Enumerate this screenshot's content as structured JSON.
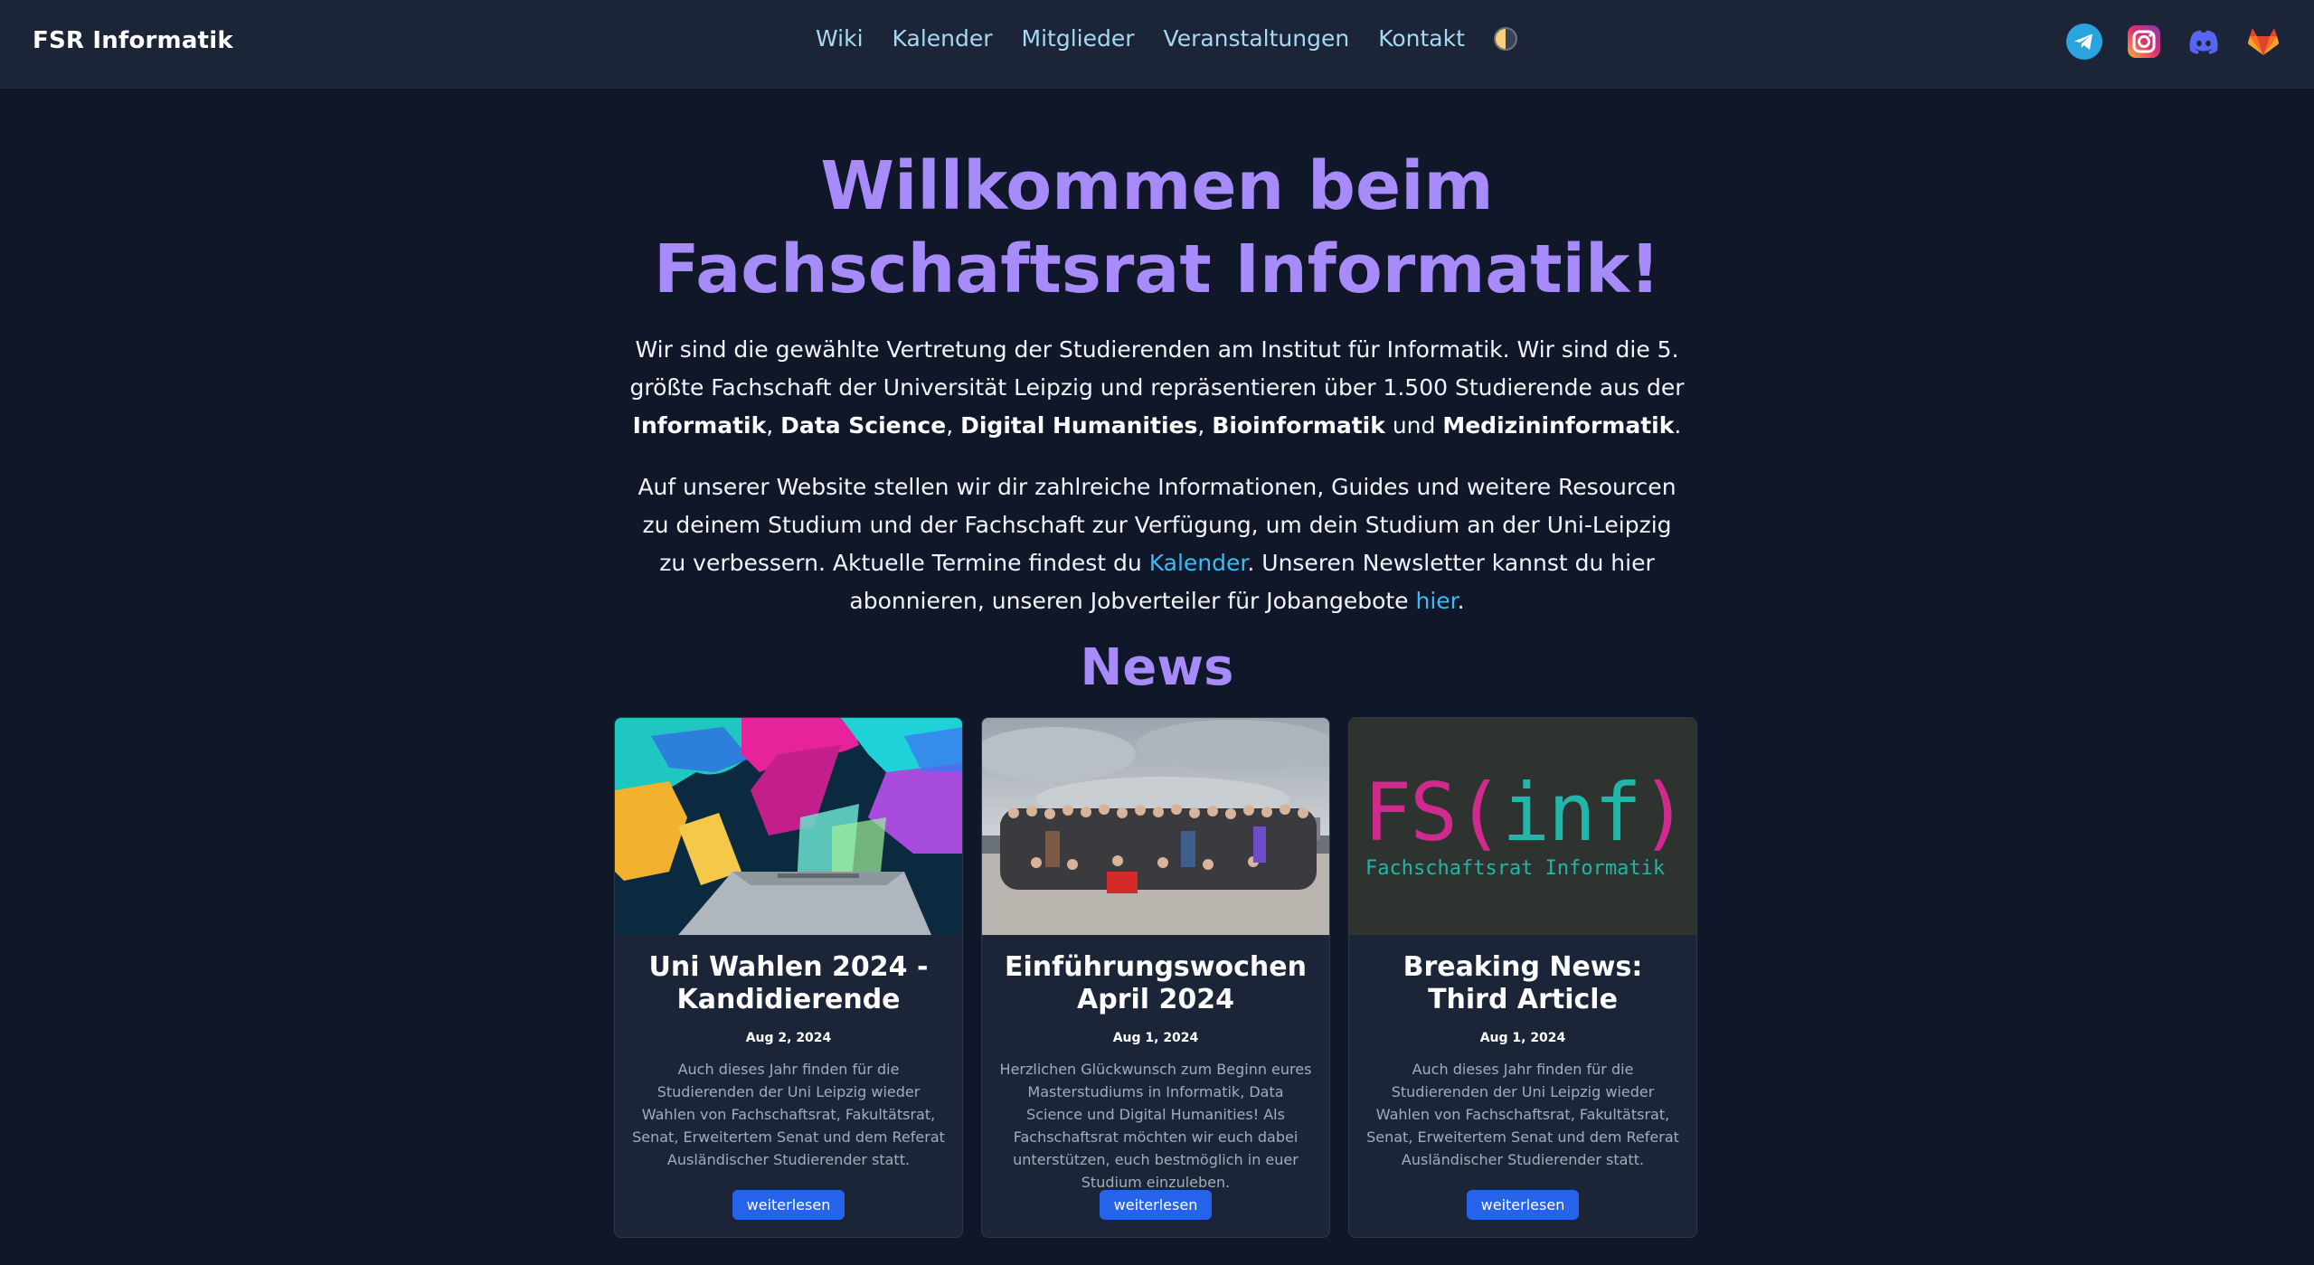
{
  "nav": {
    "brand": "FSR Informatik",
    "links": [
      "Wiki",
      "Kalender",
      "Mitglieder",
      "Veranstaltungen",
      "Kontakt"
    ],
    "social_icons": [
      "telegram-icon",
      "instagram-icon",
      "discord-icon",
      "gitlab-icon"
    ]
  },
  "hero": {
    "title_line1": "Willkommen beim",
    "title_line2": "Fachschaftsrat Informatik!",
    "p1": {
      "t1": "Wir sind die gewählte Vertretung der Studierenden am Institut für Informatik. Wir sind die 5. größte Fachschaft der Universität Leipzig und repräsentieren über 1.500 Studierende aus der ",
      "b1": "Informatik",
      "s1": ", ",
      "b2": "Data Science",
      "s2": ", ",
      "b3": "Digital Humanities",
      "s3": ", ",
      "b4": "Bioinformatik",
      "s4": " und ",
      "b5": "Medizininformatik",
      "end": "."
    },
    "p2": {
      "t1": "Auf unserer Website stellen wir dir zahlreiche Informationen, Guides und weitere Resourcen zu deinem Studium und der Fachschaft zur Verfügung, um dein Studium an der Uni-Leipzig zu verbessern. Aktuelle Termine findest du ",
      "link1": "Kalender",
      "t2": ". Unseren Newsletter kannst du hier abonnieren, unseren Jobverteiler für Jobangebote ",
      "link2": "hier",
      "end": "."
    }
  },
  "news": {
    "heading": "News",
    "cards": [
      {
        "title": "Uni Wahlen 2024 - Kandidierende",
        "date": "Aug 2, 2024",
        "text": "Auch dieses Jahr finden für die Studierenden der Uni Leipzig wieder Wahlen von Fachschaftsrat, Fakultätsrat, Senat, Erweitertem Senat und dem Referat Ausländischer Studierender statt.",
        "button": "weiterlesen"
      },
      {
        "title": "Einführungswochen April 2024",
        "date": "Aug 1, 2024",
        "text": "Herzlichen Glückwunsch zum Beginn eures Masterstudiums in Informatik, Data Science und Digital Humanities! Als Fachschaftsrat möchten wir euch dabei unterstützen, euch bestmöglich in euer Studium einzuleben.",
        "button": "weiterlesen"
      },
      {
        "title": "Breaking News: Third Article",
        "date": "Aug 1, 2024",
        "text": "Auch dieses Jahr finden für die Studierenden der Uni Leipzig wieder Wahlen von Fachschaftsrat, Fakultätsrat, Senat, Erweitertem Senat und dem Referat Ausländischer Studierender statt.",
        "button": "weiterlesen",
        "logo_main": "FS(inf)",
        "logo_sub": "Fachschaftsrat Informatik"
      }
    ]
  },
  "colors": {
    "background": "#0f1729",
    "navbar": "#1c2537",
    "accent_purple": "#a78bfa",
    "link": "#38bdf8",
    "button": "#2563eb"
  }
}
